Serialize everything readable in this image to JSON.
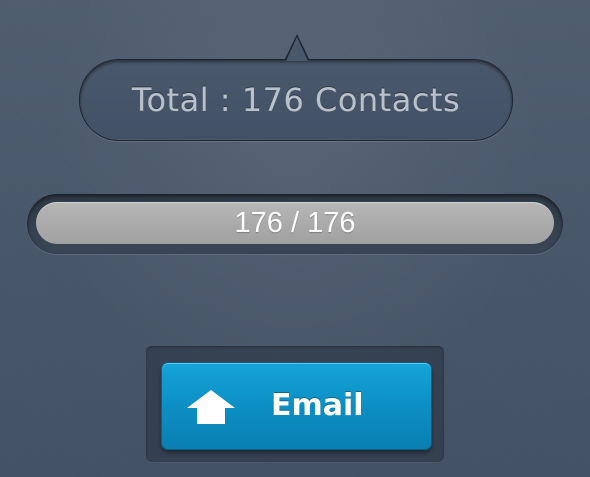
{
  "total": {
    "text": "Total : 176 Contacts"
  },
  "progress": {
    "label": "176 / 176",
    "current": 176,
    "max": 176,
    "fraction": 1.0,
    "fill_color": "#aaaaaa"
  },
  "email_button": {
    "label": "Email",
    "icon": "house-icon",
    "color": "#0c8fc4"
  }
}
